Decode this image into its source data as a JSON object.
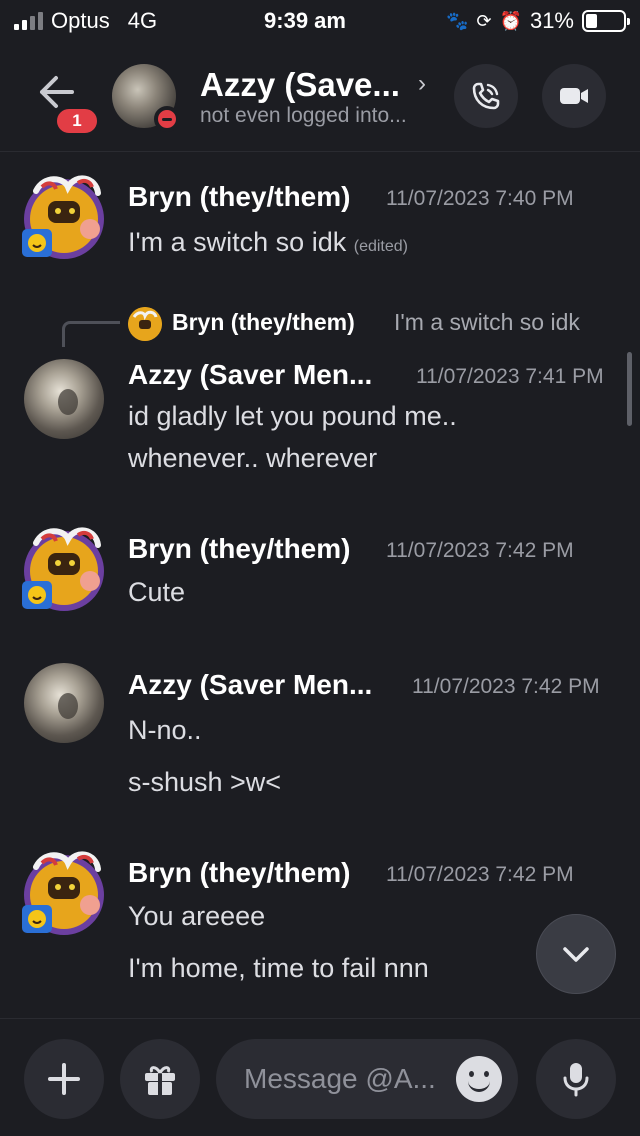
{
  "status_bar": {
    "carrier": "Optus",
    "network": "4G",
    "time": "9:39 am",
    "battery": "31%",
    "battery_level": 0.31
  },
  "header": {
    "unread_badge": "1",
    "contact_name": "Azzy (Save...",
    "contact_status": "not even logged into...",
    "presence": "do-not-disturb"
  },
  "messages": [
    {
      "author": "Bryn (they/them)",
      "timestamp": "11/07/2023 7:40 PM",
      "lines": [
        "I'm a switch so idk"
      ],
      "edited": "(edited)"
    },
    {
      "reply_to": {
        "author": "Bryn (they/them)",
        "text": "I'm a switch so idk"
      },
      "author": "Azzy (Saver Men...",
      "timestamp": "11/07/2023 7:41 PM",
      "lines": [
        "id gladly let you pound me..",
        "whenever.. wherever"
      ]
    },
    {
      "author": "Bryn (they/them)",
      "timestamp": "11/07/2023 7:42 PM",
      "lines": [
        "Cute"
      ]
    },
    {
      "author": "Azzy (Saver Men...",
      "timestamp": "11/07/2023 7:42 PM",
      "lines": [
        "N-no..",
        "s-shush >w<"
      ]
    },
    {
      "author": "Bryn (they/them)",
      "timestamp": "11/07/2023 7:42 PM",
      "lines": [
        "You areeee",
        "I'm home, time to fail nnn"
      ]
    }
  ],
  "composer": {
    "placeholder": "Message @A..."
  },
  "icons": {
    "back": "arrow-left-icon",
    "call": "phone-icon",
    "video": "video-camera-icon",
    "jump": "chevron-down-icon",
    "plus": "plus-icon",
    "gift": "gift-icon",
    "emoji": "emoji-icon",
    "mic": "microphone-icon"
  },
  "colors": {
    "background": "#1c1d22",
    "badge": "#e23d45",
    "button_bg": "#2b2c33"
  }
}
